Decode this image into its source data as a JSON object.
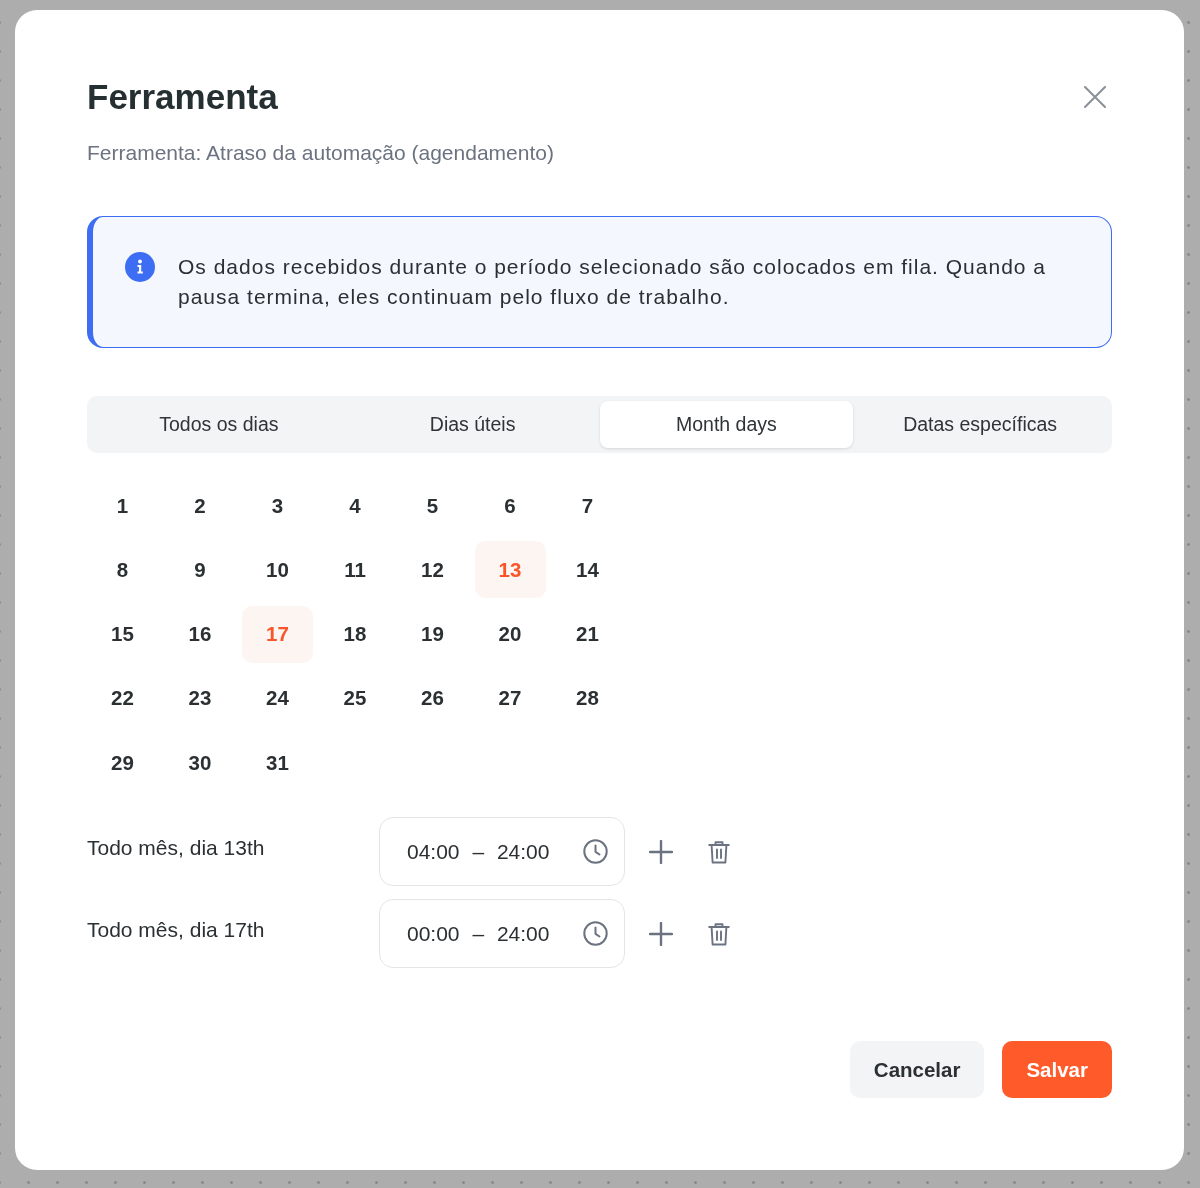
{
  "dialog": {
    "title": "Ferramenta",
    "subtitle": "Ferramenta: Atraso da automação (agendamento)"
  },
  "info_banner": {
    "text": "Os dados recebidos durante o período selecionado são colocados em fila. Quando a pausa termina, eles continuam pelo fluxo de trabalho."
  },
  "tabs": [
    {
      "label": "Todos os dias",
      "selected": false
    },
    {
      "label": "Dias úteis",
      "selected": false
    },
    {
      "label": "Month days",
      "selected": true
    },
    {
      "label": "Datas específicas",
      "selected": false
    }
  ],
  "month_days": [
    {
      "day": "1",
      "selected": false
    },
    {
      "day": "2",
      "selected": false
    },
    {
      "day": "3",
      "selected": false
    },
    {
      "day": "4",
      "selected": false
    },
    {
      "day": "5",
      "selected": false
    },
    {
      "day": "6",
      "selected": false
    },
    {
      "day": "7",
      "selected": false
    },
    {
      "day": "8",
      "selected": false
    },
    {
      "day": "9",
      "selected": false
    },
    {
      "day": "10",
      "selected": false
    },
    {
      "day": "11",
      "selected": false
    },
    {
      "day": "12",
      "selected": false
    },
    {
      "day": "13",
      "selected": true
    },
    {
      "day": "14",
      "selected": false
    },
    {
      "day": "15",
      "selected": false
    },
    {
      "day": "16",
      "selected": false
    },
    {
      "day": "17",
      "selected": true
    },
    {
      "day": "18",
      "selected": false
    },
    {
      "day": "19",
      "selected": false
    },
    {
      "day": "20",
      "selected": false
    },
    {
      "day": "21",
      "selected": false
    },
    {
      "day": "22",
      "selected": false
    },
    {
      "day": "23",
      "selected": false
    },
    {
      "day": "24",
      "selected": false
    },
    {
      "day": "25",
      "selected": false
    },
    {
      "day": "26",
      "selected": false
    },
    {
      "day": "27",
      "selected": false
    },
    {
      "day": "28",
      "selected": false
    },
    {
      "day": "29",
      "selected": false
    },
    {
      "day": "30",
      "selected": false
    },
    {
      "day": "31",
      "selected": false
    }
  ],
  "schedules": [
    {
      "label": "Todo mês, dia 13th",
      "time_range": "04:00 – 24:00"
    },
    {
      "label": "Todo mês, dia 17th",
      "time_range": "00:00 – 24:00"
    }
  ],
  "buttons": [
    {
      "label": "Cancelar",
      "kind": "secondary"
    },
    {
      "label": "Salvar",
      "kind": "primary"
    }
  ]
}
